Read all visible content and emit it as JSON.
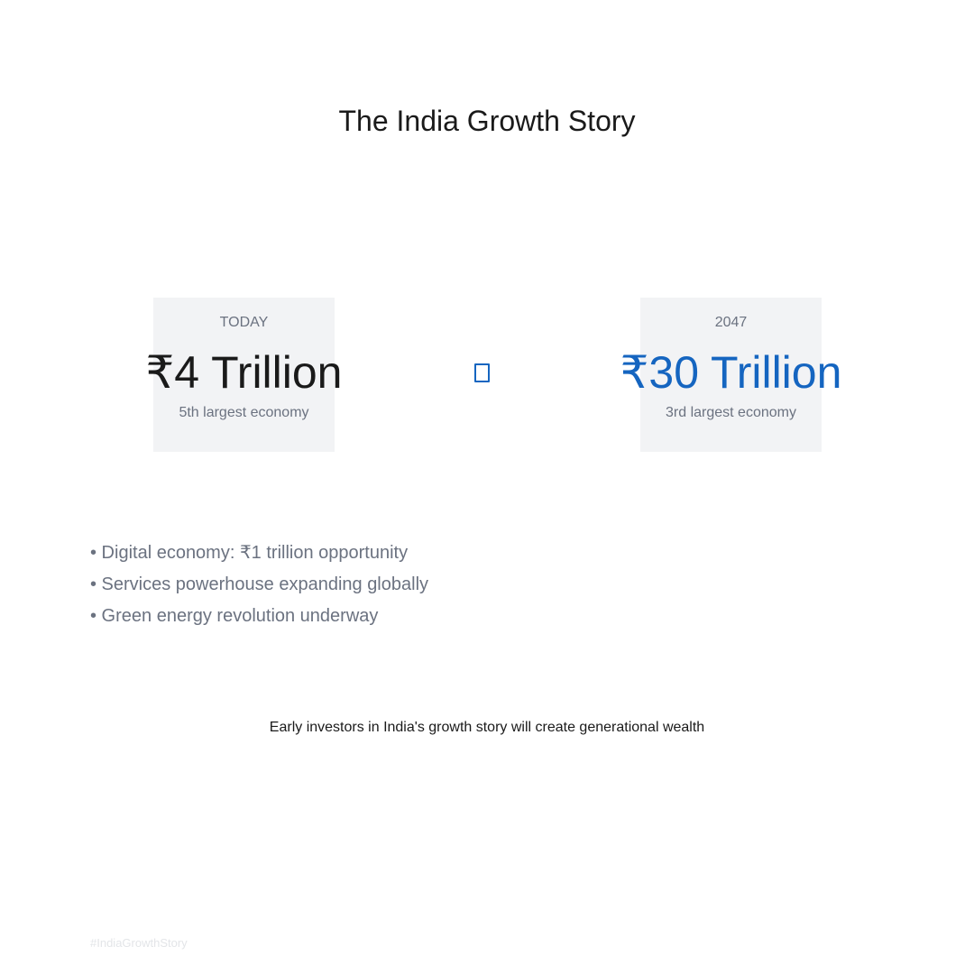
{
  "title": "The India Growth Story",
  "today": {
    "label": "TODAY",
    "value": "₹4 Trillion",
    "note": "5th largest economy"
  },
  "future": {
    "label": "2047",
    "value": "₹30 Trillion",
    "note": "3rd largest economy"
  },
  "points": [
    "• Digital economy: ₹1 trillion opportunity",
    "• Services powerhouse expanding globally",
    "• Green energy revolution underway"
  ],
  "tagline": "Early investors in India's growth story will create generational wealth",
  "hashtag": "#IndiaGrowthStory",
  "colors": {
    "accent": "#1565c0",
    "text": "#1a1a1a",
    "muted": "#6b7280",
    "card_bg": "#f2f3f5"
  },
  "icons": {
    "connector": "arrow-icon"
  }
}
